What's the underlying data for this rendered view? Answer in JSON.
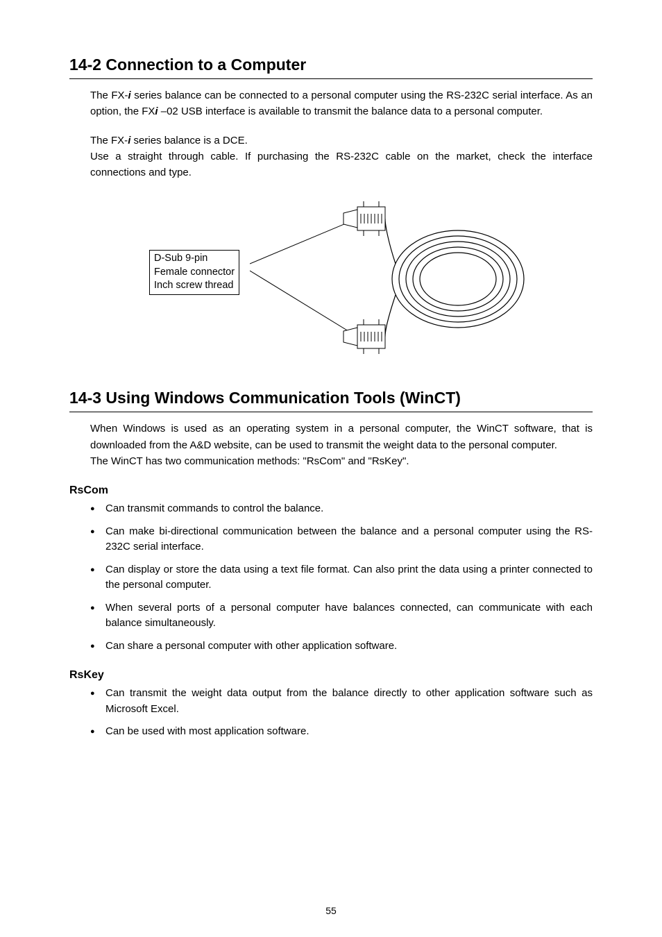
{
  "section1": {
    "heading": "14-2  Connection to a Computer",
    "p1_a": "The FX-",
    "p1_b": " series balance can be connected to a personal computer using the RS-232C serial interface. As an option, the FX",
    "p1_c": " –02 USB interface is available to transmit the balance data to a personal computer.",
    "p2_a": "The FX-",
    "p2_b": " series balance is a DCE.",
    "p3": "Use a straight through cable. If purchasing the RS-232C cable on the market, check the interface connections and type.",
    "callout_l1": "D-Sub 9-pin",
    "callout_l2": "Female connector",
    "callout_l3": "Inch screw thread"
  },
  "section2": {
    "heading": "14-3  Using Windows Communication Tools (WinCT)",
    "p1": "When Windows is used as an operating system in a personal computer, the WinCT software, that is downloaded from the A&D website, can be used to transmit the weight data to the personal computer.",
    "p2": "The WinCT has two communication methods: \"RsCom\" and \"RsKey\".",
    "rscom_heading": "RsCom",
    "rscom_items": [
      "Can transmit commands to control the balance.",
      "Can make bi-directional communication between the balance and a personal computer using the RS-232C serial interface.",
      "Can display or store the data using a text file format. Can also print the data using a printer connected to the personal computer.",
      "When several ports of a personal computer have balances connected, can communicate with each balance simultaneously.",
      "Can share a personal computer with other application software."
    ],
    "rskey_heading": "RsKey",
    "rskey_items": [
      "Can transmit the weight data output from the balance directly to other application software such as Microsoft Excel.",
      "Can be used with most application software."
    ]
  },
  "page_number": "55",
  "italic_i": "i"
}
